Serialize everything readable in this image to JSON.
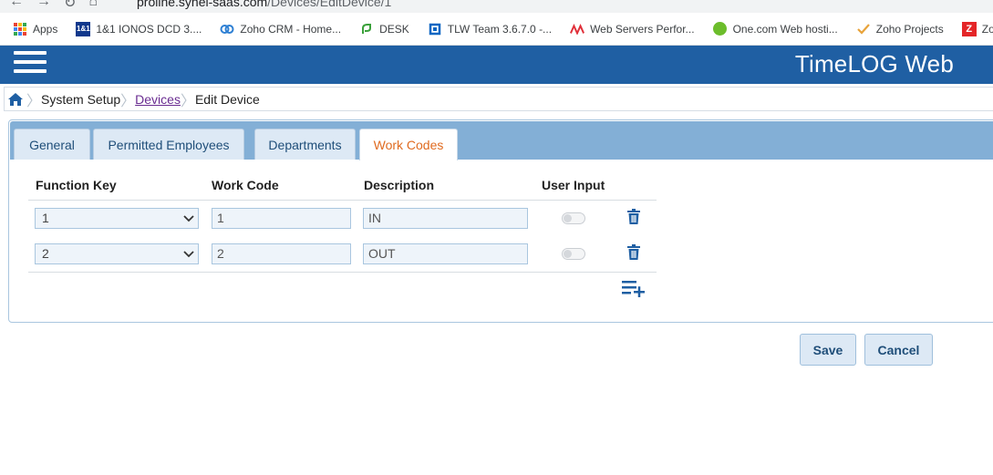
{
  "browser": {
    "url_host": "proline.synel-saas.com",
    "url_path": "/Devices/EditDevice/1",
    "bookmarks": [
      {
        "label": "Apps",
        "icon": "apps-grid-icon"
      },
      {
        "label": "1&1 IONOS DCD 3....",
        "icon": "ionos-icon",
        "icon_text": "1&1"
      },
      {
        "label": "Zoho CRM - Home...",
        "icon": "zoho-crm-icon"
      },
      {
        "label": "DESK",
        "icon": "desk-icon"
      },
      {
        "label": "TLW Team 3.6.7.0 -...",
        "icon": "tlw-icon"
      },
      {
        "label": "Web Servers Perfor...",
        "icon": "web-servers-icon"
      },
      {
        "label": "One.com Web hosti...",
        "icon": "onecom-icon"
      },
      {
        "label": "Zoho Projects",
        "icon": "zoho-projects-icon"
      },
      {
        "label": "Zoho I",
        "icon": "zoho-icon",
        "icon_text": "Z"
      }
    ]
  },
  "header": {
    "brand": "TimeLOG Web"
  },
  "breadcrumb": {
    "items": [
      "System Setup",
      "Devices",
      "Edit Device"
    ]
  },
  "tabs": [
    {
      "label": "General",
      "active": false
    },
    {
      "label": "Permitted Employees",
      "active": false
    },
    {
      "label": "Departments",
      "active": false
    },
    {
      "label": "Work Codes",
      "active": true
    }
  ],
  "table": {
    "columns": [
      "Function Key",
      "Work Code",
      "Description",
      "User Input"
    ],
    "rows": [
      {
        "function_key": "1",
        "work_code": "1",
        "description": "IN",
        "user_input": false
      },
      {
        "function_key": "2",
        "work_code": "2",
        "description": "OUT",
        "user_input": false
      }
    ]
  },
  "buttons": {
    "save": "Save",
    "cancel": "Cancel"
  },
  "colors": {
    "header_bg": "#1f5fa3",
    "tabbar_bg": "#83afd6",
    "active_tab_text": "#e06b20",
    "link": "#6a2c91"
  }
}
